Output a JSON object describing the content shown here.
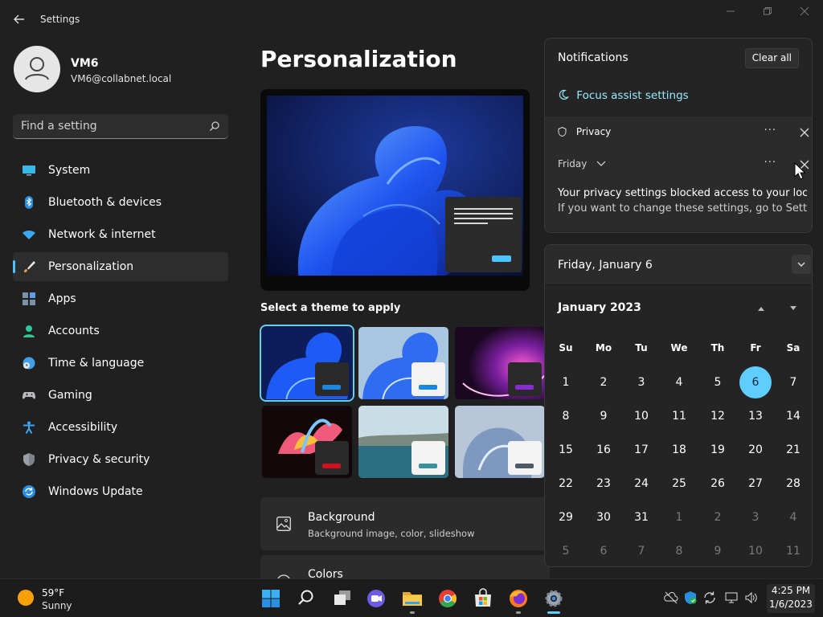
{
  "window": {
    "title": "Settings"
  },
  "user": {
    "name": "VM6",
    "email": "VM6@collabnet.local"
  },
  "search": {
    "placeholder": "Find a setting"
  },
  "sidebar": {
    "items": [
      {
        "label": "System"
      },
      {
        "label": "Bluetooth & devices"
      },
      {
        "label": "Network & internet"
      },
      {
        "label": "Personalization",
        "selected": true
      },
      {
        "label": "Apps"
      },
      {
        "label": "Accounts"
      },
      {
        "label": "Time & language"
      },
      {
        "label": "Gaming"
      },
      {
        "label": "Accessibility"
      },
      {
        "label": "Privacy & security"
      },
      {
        "label": "Windows Update"
      }
    ]
  },
  "main": {
    "title": "Personalization",
    "theme_section": "Select a theme to apply",
    "cards": [
      {
        "title": "Background",
        "subtitle": "Background image, color, slideshow"
      },
      {
        "title": "Colors",
        "subtitle": ""
      }
    ]
  },
  "notifications": {
    "title": "Notifications",
    "clear_all": "Clear all",
    "focus_assist": "Focus assist settings",
    "app": "Privacy",
    "group": "Friday",
    "body_line1": "Your privacy settings blocked access to your locat",
    "body_line2": "If you want to change these settings, go to Settin"
  },
  "calendar": {
    "date_header": "Friday, January 6",
    "month": "January 2023",
    "weekdays": [
      "Su",
      "Mo",
      "Tu",
      "We",
      "Th",
      "Fr",
      "Sa"
    ],
    "today": "6",
    "days": [
      "1",
      "2",
      "3",
      "4",
      "5",
      "6",
      "7",
      "8",
      "9",
      "10",
      "11",
      "12",
      "13",
      "14",
      "15",
      "16",
      "17",
      "18",
      "19",
      "20",
      "21",
      "22",
      "23",
      "24",
      "25",
      "26",
      "27",
      "28",
      "29",
      "30",
      "31",
      "1",
      "2",
      "3",
      "4",
      "5",
      "6",
      "7",
      "8",
      "9",
      "10",
      "11"
    ]
  },
  "taskbar": {
    "weather_temp": "59°F",
    "weather_cond": "Sunny",
    "time": "4:25 PM",
    "date": "1/6/2023"
  },
  "colors": {
    "accent": "#60cdff",
    "today_bg": "#60cdff",
    "focus_link": "#99ebff"
  }
}
